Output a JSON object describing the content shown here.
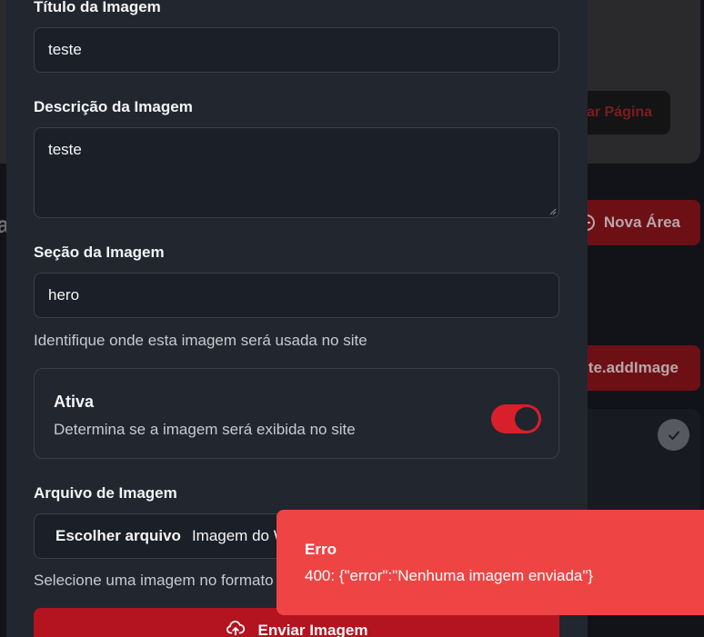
{
  "background": {
    "top_button_label": "ar Página",
    "new_area_label": "Nova Área",
    "add_image_label": "ite.addImage",
    "side_letter": "a"
  },
  "modal": {
    "title_field": {
      "label": "Título da Imagem",
      "value": "teste"
    },
    "description_field": {
      "label": "Descrição da Imagem",
      "value": "teste"
    },
    "section_field": {
      "label": "Seção da Imagem",
      "value": "hero",
      "helper": "Identifique onde esta imagem será usada no site"
    },
    "active_toggle": {
      "title": "Ativa",
      "description": "Determina se a imagem será exibida no site",
      "enabled": true
    },
    "file_field": {
      "label": "Arquivo de Imagem",
      "button_label": "Escolher arquivo",
      "file_name": "Imagem do W",
      "helper": "Selecione uma imagem no formato"
    },
    "submit_label": "Enviar Imagem"
  },
  "toast": {
    "title": "Erro",
    "message": "400: {\"error\":\"Nenhuma imagem enviada\"}"
  },
  "colors": {
    "accent_red": "#b3141f",
    "toast_red": "#ef4444",
    "modal_bg": "#22262f"
  }
}
